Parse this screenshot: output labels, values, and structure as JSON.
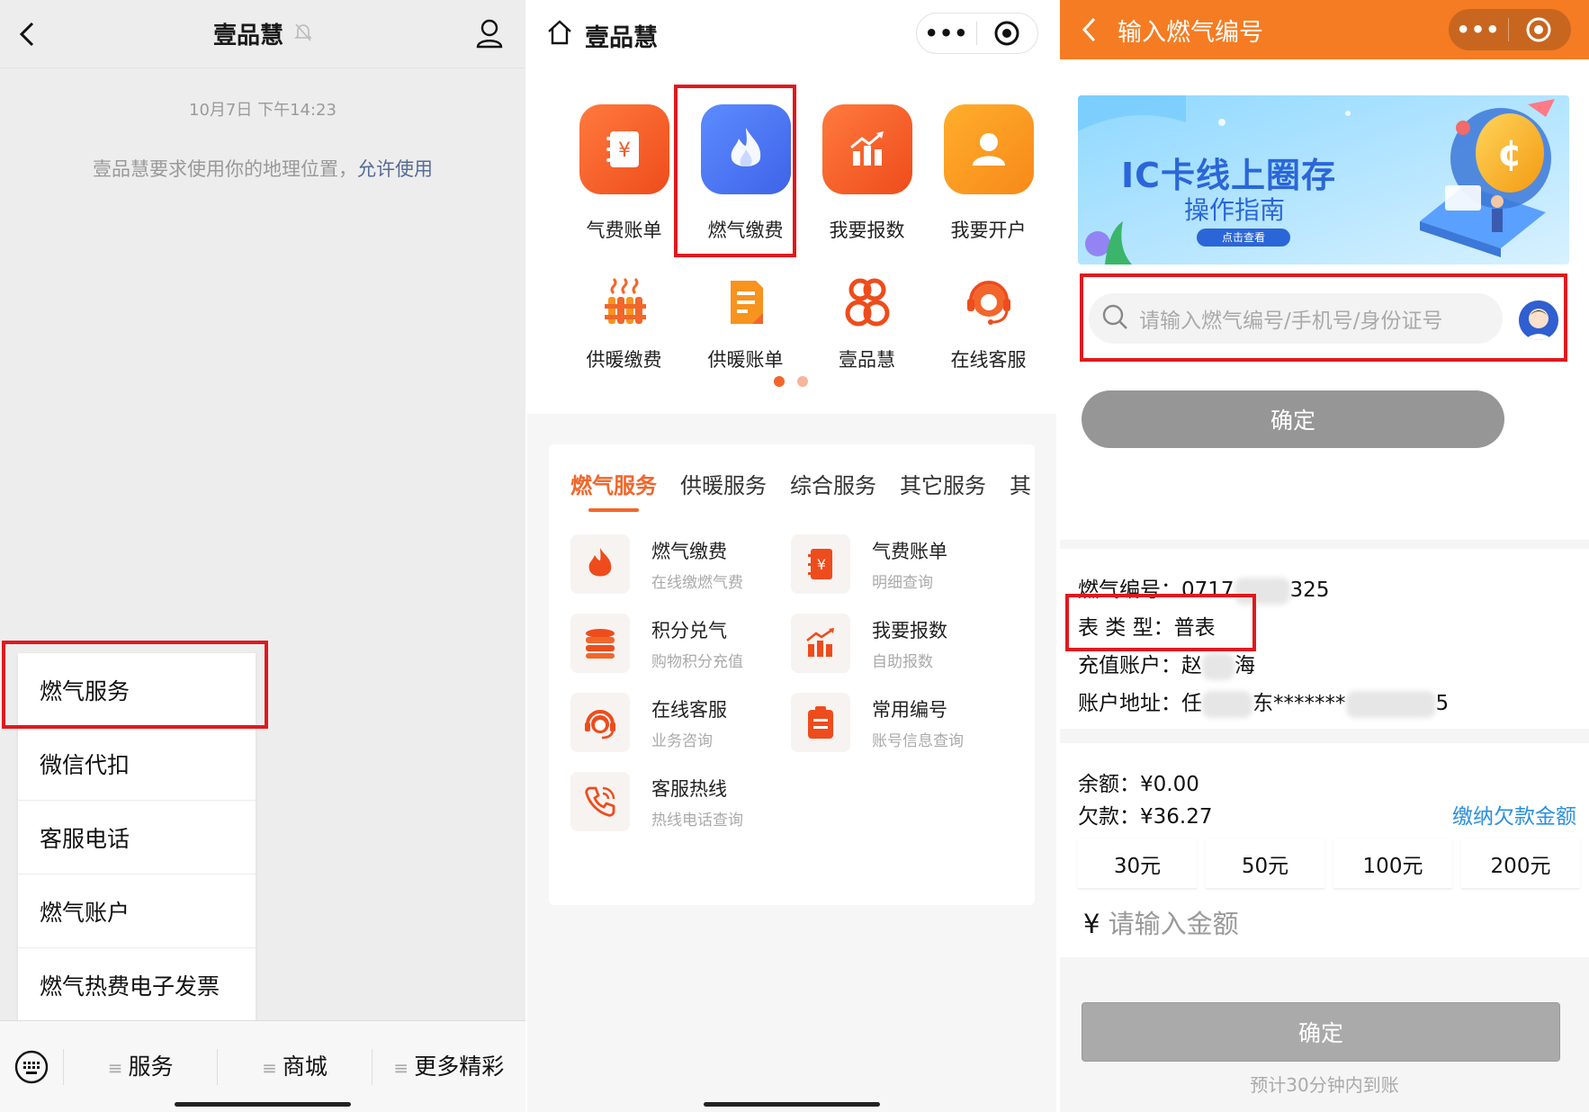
{
  "panel1": {
    "title": "壹品慧",
    "timestamp": "10月7日 下午14:23",
    "notice": "壹品慧要求使用你的地理位置，",
    "notice_link": "允许使用",
    "menu": [
      "燃气服务",
      "微信代扣",
      "客服电话",
      "燃气账户",
      "燃气热费电子发票"
    ],
    "bottom_tabs": [
      "服务",
      "商城",
      "更多精彩"
    ]
  },
  "panel2": {
    "title": "壹品慧",
    "capsule_dots": "•••",
    "top_icons": [
      {
        "label": "气费账单",
        "icon": "bill-icon",
        "color": "#f2662b"
      },
      {
        "label": "燃气缴费",
        "icon": "flame-icon",
        "color": "#4f7cf0"
      },
      {
        "label": "我要报数",
        "icon": "chart-icon",
        "color": "#f2662b"
      },
      {
        "label": "我要开户",
        "icon": "user-icon",
        "color": "#f7931e"
      }
    ],
    "second_icons": [
      {
        "label": "供暖缴费",
        "icon": "radiator-icon"
      },
      {
        "label": "供暖账单",
        "icon": "document-icon"
      },
      {
        "label": "壹品慧",
        "icon": "brand-logo-icon"
      },
      {
        "label": "在线客服",
        "icon": "headset-icon"
      }
    ],
    "tabs": [
      "燃气服务",
      "供暖服务",
      "综合服务",
      "其它服务",
      "其"
    ],
    "services": [
      {
        "name": "燃气缴费",
        "desc": "在线缴燃气费",
        "icon": "flame-icon"
      },
      {
        "name": "气费账单",
        "desc": "明细查询",
        "icon": "bill-icon"
      },
      {
        "name": "积分兑气",
        "desc": "购物积分充值",
        "icon": "coins-icon"
      },
      {
        "name": "我要报数",
        "desc": "自助报数",
        "icon": "chart-icon"
      },
      {
        "name": "在线客服",
        "desc": "业务咨询",
        "icon": "headset-icon"
      },
      {
        "name": "常用编号",
        "desc": "账号信息查询",
        "icon": "clipboard-icon"
      },
      {
        "name": "客服热线",
        "desc": "热线电话查询",
        "icon": "phone-icon"
      }
    ],
    "accent_color": "#f2662b"
  },
  "panel3": {
    "title": "输入燃气编号",
    "header_color": "#f57c22",
    "banner": {
      "title": "IC卡线上圈存",
      "subtitle": "操作指南",
      "button": "点击查看"
    },
    "search_placeholder": "请输入燃气编号/手机号/身份证号",
    "confirm_label": "确定",
    "gas_no_label": "燃气编号：",
    "gas_no_prefix": "0717",
    "gas_no_suffix": "325",
    "meter_type_label": "表 类 型：",
    "meter_type": "普表",
    "account_label": "充值账户：",
    "account_prefix": "赵",
    "account_suffix": "海",
    "address_label": "账户地址：",
    "address_prefix": "任",
    "address_mid": "东*******",
    "address_suffix": "5",
    "balance_label": "余额：",
    "balance": "¥0.00",
    "arrears_label": "欠款：",
    "arrears": "¥36.27",
    "pay_arrears_link": "缴纳欠款金额",
    "amounts": [
      "30元",
      "50元",
      "100元",
      "200元"
    ],
    "amount_currency": "¥",
    "amount_placeholder": "请输入金额",
    "confirm2_label": "确定",
    "hint": "预计30分钟内到账"
  }
}
